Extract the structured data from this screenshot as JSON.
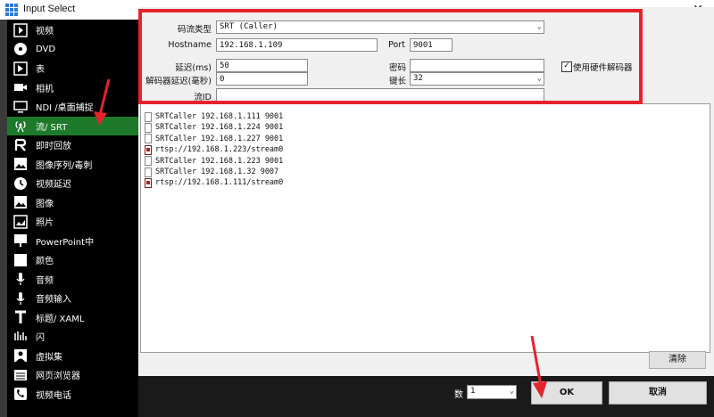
{
  "window": {
    "title": "Input Select",
    "close_glyph": "✕"
  },
  "sidebar": {
    "items": [
      {
        "label": "视频",
        "icon": "video-play-icon"
      },
      {
        "label": "DVD",
        "icon": "disc-icon"
      },
      {
        "label": "表",
        "icon": "list-play-icon"
      },
      {
        "label": "相机",
        "icon": "camera-icon"
      },
      {
        "label": "NDI /桌面捕捉",
        "icon": "monitor-icon"
      },
      {
        "label": "流/ SRT",
        "icon": "stream-antenna-icon"
      },
      {
        "label": "即时回放",
        "icon": "replay-icon"
      },
      {
        "label": "图像序列/毒刺",
        "icon": "image-sequence-icon"
      },
      {
        "label": "视频延迟",
        "icon": "clock-icon"
      },
      {
        "label": "图像",
        "icon": "image-icon"
      },
      {
        "label": "照片",
        "icon": "photo-icon"
      },
      {
        "label": "PowerPoint中",
        "icon": "presentation-icon"
      },
      {
        "label": "颜色",
        "icon": "color-icon"
      },
      {
        "label": "音频",
        "icon": "microphone-icon"
      },
      {
        "label": "音频输入",
        "icon": "microphone-input-icon"
      },
      {
        "label": "标题/ XAML",
        "icon": "title-icon"
      },
      {
        "label": "闪",
        "icon": "flash-icon"
      },
      {
        "label": "虚拟集",
        "icon": "virtual-set-icon"
      },
      {
        "label": "网页浏览器",
        "icon": "browser-icon"
      },
      {
        "label": "视频电话",
        "icon": "video-call-icon"
      }
    ],
    "active_index": 5
  },
  "form": {
    "stream_type_label": "码流类型",
    "stream_type_value": "SRT (Caller)",
    "hostname_label": "Hostname",
    "hostname_value": "192.168.1.109",
    "port_label": "Port",
    "port_value": "9001",
    "latency_label": "延迟(ms)",
    "latency_value": "50",
    "password_label": "密码",
    "password_value": "",
    "decoder_delay_label": "解码器延迟(毫秒)",
    "decoder_delay_value": "0",
    "key_length_label": "键长",
    "key_length_value": "32",
    "stream_id_label": "流ID",
    "stream_id_value": "",
    "hw_decoder_label": "使用硬件解码器",
    "hw_decoder_checked": true
  },
  "history": [
    {
      "text": "SRTCaller 192.168.1.111 9001",
      "kind": "file"
    },
    {
      "text": "SRTCaller 192.168.1.224 9001",
      "kind": "file"
    },
    {
      "text": "SRTCaller 192.168.1.227 9001",
      "kind": "file"
    },
    {
      "text": "rtsp://192.168.1.223/stream0",
      "kind": "media"
    },
    {
      "text": "SRTCaller 192.168.1.223 9001",
      "kind": "file"
    },
    {
      "text": "SRTCaller 192.168.1.32 9007",
      "kind": "file"
    },
    {
      "text": "rtsp://192.168.1.111/stream0",
      "kind": "media"
    }
  ],
  "buttons": {
    "clear": "清除",
    "count_label": "数",
    "count_value": "1",
    "ok": "OK",
    "cancel": "取消"
  },
  "colors": {
    "accent_green": "#1c7a2a",
    "highlight_red": "#e5232c"
  }
}
